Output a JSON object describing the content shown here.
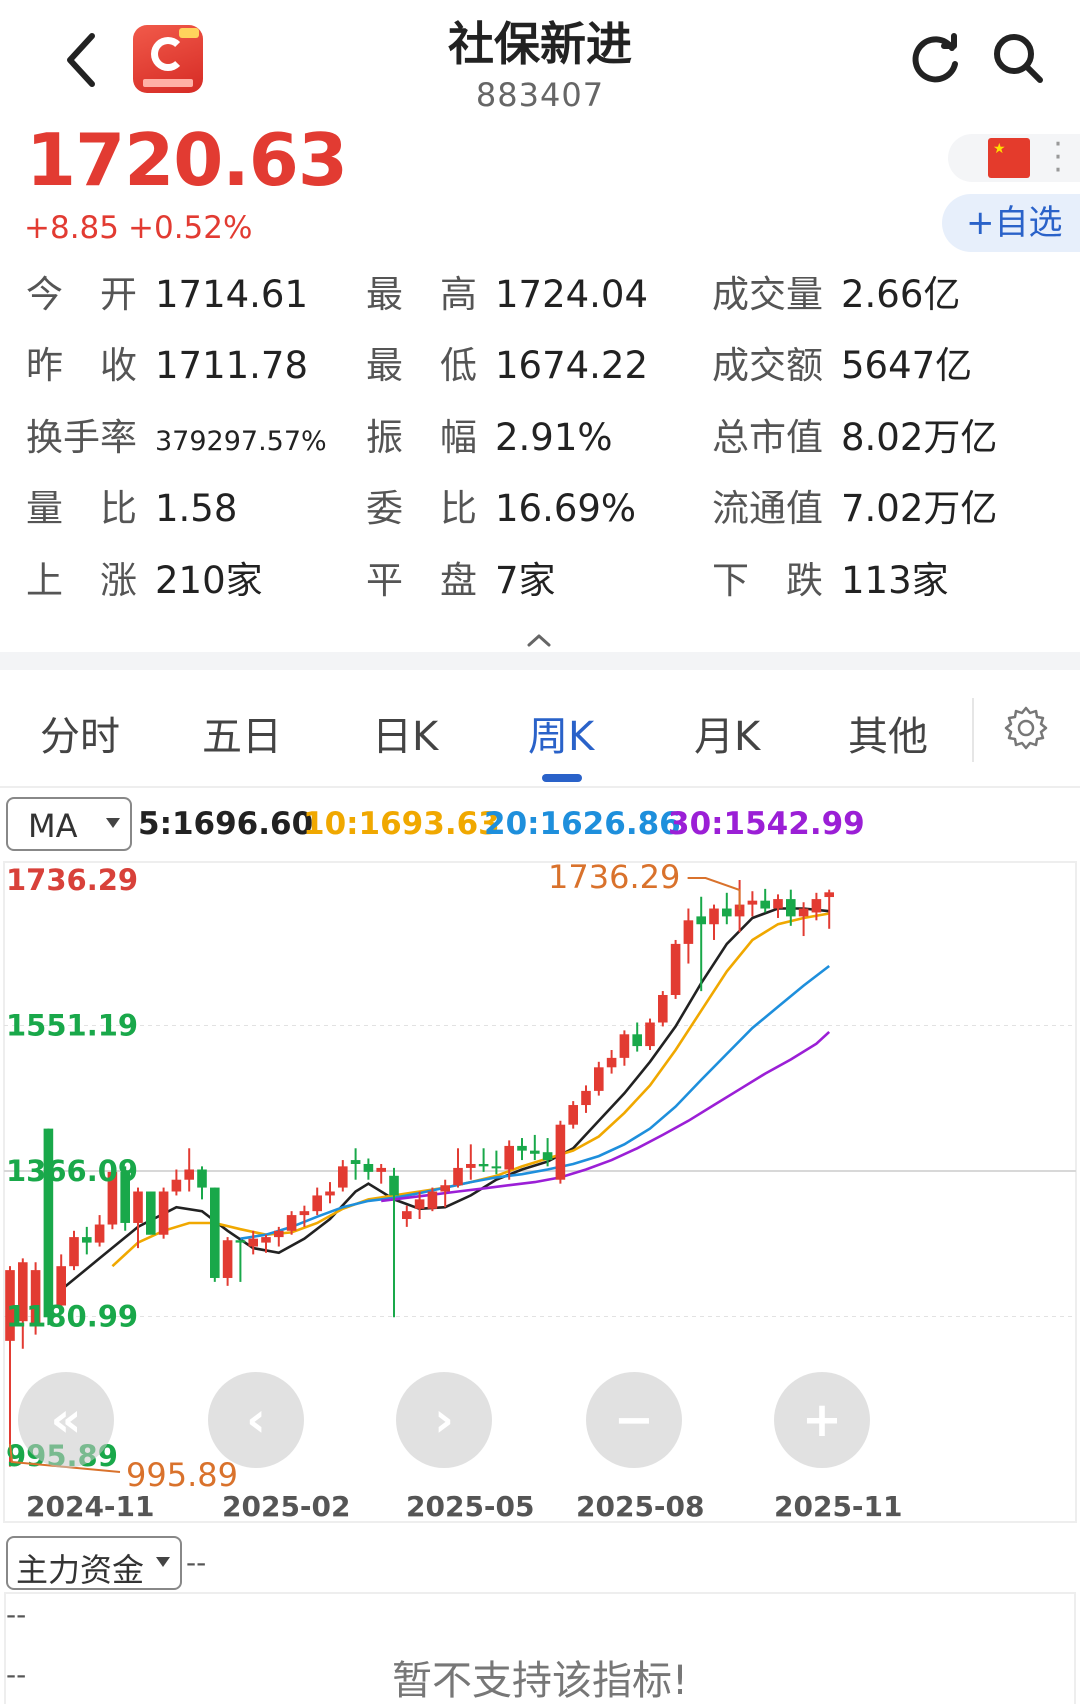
{
  "header": {
    "title": "社保新进",
    "code": "883407"
  },
  "quote": {
    "price": "1720.63",
    "change_abs": "+8.85",
    "change_pct": "+0.52%",
    "fav_label": "+自选"
  },
  "stats": [
    {
      "label": "今　开",
      "value": "1714.61"
    },
    {
      "label": "最　高",
      "value": "1724.04"
    },
    {
      "label": "成交量",
      "value": "2.66亿"
    },
    {
      "label": "昨　收",
      "value": "1711.78"
    },
    {
      "label": "最　低",
      "value": "1674.22"
    },
    {
      "label": "成交额",
      "value": "5647亿"
    },
    {
      "label": "换手率",
      "value": "379297.57%"
    },
    {
      "label": "振　幅",
      "value": "2.91%"
    },
    {
      "label": "总市值",
      "value": "8.02万亿"
    },
    {
      "label": "量　比",
      "value": "1.58"
    },
    {
      "label": "委　比",
      "value": "16.69%"
    },
    {
      "label": "流通值",
      "value": "7.02万亿"
    },
    {
      "label": "上　涨",
      "value": "210家"
    },
    {
      "label": "平　盘",
      "value": "7家"
    },
    {
      "label": "下　跌",
      "value": "113家"
    }
  ],
  "tabs": [
    "分时",
    "五日",
    "日K",
    "周K",
    "月K",
    "其他"
  ],
  "active_tab": "周K",
  "ma": {
    "select_label": "MA",
    "values": [
      {
        "label": "5:1696.60",
        "color": "#222222"
      },
      {
        "label": "10:1693.63",
        "color": "#f0a800"
      },
      {
        "label": "20:1626.86",
        "color": "#1e8fdc"
      },
      {
        "label": "30:1542.99",
        "color": "#9b1fd6"
      }
    ]
  },
  "axis": {
    "y_labels": [
      "1736.29",
      "1551.19",
      "1366.09",
      "1180.99",
      "995.89"
    ],
    "high_marker": "1736.29",
    "low_marker": "995.89",
    "dates": [
      "2024-11",
      "2025-02",
      "2025-05",
      "2025-08",
      "2025-11"
    ]
  },
  "chart_data": {
    "type": "candlestick",
    "period": "weekly",
    "ylim": [
      995.89,
      1736.29
    ],
    "y_ticks": [
      1736.29,
      1551.19,
      1366.09,
      1180.99,
      995.89
    ],
    "x_tick_labels": [
      "2024-11",
      "2025-02",
      "2025-05",
      "2025-08",
      "2025-11"
    ],
    "up_color": "#e23b32",
    "down_color": "#19a84a",
    "candles": [
      {
        "o": 1150,
        "h": 1245,
        "l": 990,
        "c": 1240
      },
      {
        "o": 1175,
        "h": 1255,
        "l": 1140,
        "c": 1250
      },
      {
        "o": 1170,
        "h": 1250,
        "l": 1158,
        "c": 1240
      },
      {
        "o": 1420,
        "h": 1420,
        "l": 1170,
        "c": 1180
      },
      {
        "o": 1195,
        "h": 1260,
        "l": 1185,
        "c": 1245
      },
      {
        "o": 1245,
        "h": 1290,
        "l": 1240,
        "c": 1282
      },
      {
        "o": 1282,
        "h": 1295,
        "l": 1260,
        "c": 1275
      },
      {
        "o": 1275,
        "h": 1310,
        "l": 1270,
        "c": 1298
      },
      {
        "o": 1298,
        "h": 1370,
        "l": 1292,
        "c": 1365
      },
      {
        "o": 1365,
        "h": 1372,
        "l": 1290,
        "c": 1300
      },
      {
        "o": 1300,
        "h": 1345,
        "l": 1268,
        "c": 1340
      },
      {
        "o": 1340,
        "h": 1335,
        "l": 1295,
        "c": 1285
      },
      {
        "o": 1285,
        "h": 1345,
        "l": 1280,
        "c": 1340
      },
      {
        "o": 1340,
        "h": 1368,
        "l": 1335,
        "c": 1355
      },
      {
        "o": 1355,
        "h": 1395,
        "l": 1340,
        "c": 1368
      },
      {
        "o": 1368,
        "h": 1372,
        "l": 1330,
        "c": 1345
      },
      {
        "o": 1345,
        "h": 1345,
        "l": 1225,
        "c": 1230
      },
      {
        "o": 1230,
        "h": 1282,
        "l": 1220,
        "c": 1278
      },
      {
        "o": 1278,
        "h": 1278,
        "l": 1225,
        "c": 1275
      },
      {
        "o": 1270,
        "h": 1290,
        "l": 1260,
        "c": 1280
      },
      {
        "o": 1275,
        "h": 1285,
        "l": 1262,
        "c": 1282
      },
      {
        "o": 1282,
        "h": 1295,
        "l": 1270,
        "c": 1290
      },
      {
        "o": 1290,
        "h": 1315,
        "l": 1285,
        "c": 1310
      },
      {
        "o": 1310,
        "h": 1322,
        "l": 1295,
        "c": 1315
      },
      {
        "o": 1315,
        "h": 1345,
        "l": 1310,
        "c": 1335
      },
      {
        "o": 1335,
        "h": 1352,
        "l": 1325,
        "c": 1340
      },
      {
        "o": 1345,
        "h": 1380,
        "l": 1340,
        "c": 1372
      },
      {
        "o": 1380,
        "h": 1395,
        "l": 1355,
        "c": 1375
      },
      {
        "o": 1375,
        "h": 1382,
        "l": 1355,
        "c": 1365
      },
      {
        "o": 1365,
        "h": 1375,
        "l": 1350,
        "c": 1370
      },
      {
        "o": 1360,
        "h": 1370,
        "l": 1180,
        "c": 1335
      },
      {
        "o": 1305,
        "h": 1322,
        "l": 1295,
        "c": 1315
      },
      {
        "o": 1318,
        "h": 1340,
        "l": 1305,
        "c": 1330
      },
      {
        "o": 1318,
        "h": 1345,
        "l": 1315,
        "c": 1340
      },
      {
        "o": 1340,
        "h": 1355,
        "l": 1320,
        "c": 1348
      },
      {
        "o": 1348,
        "h": 1395,
        "l": 1345,
        "c": 1370
      },
      {
        "o": 1370,
        "h": 1400,
        "l": 1355,
        "c": 1375
      },
      {
        "o": 1375,
        "h": 1395,
        "l": 1365,
        "c": 1372
      },
      {
        "o": 1372,
        "h": 1392,
        "l": 1362,
        "c": 1370
      },
      {
        "o": 1368,
        "h": 1405,
        "l": 1355,
        "c": 1398
      },
      {
        "o": 1398,
        "h": 1408,
        "l": 1380,
        "c": 1392
      },
      {
        "o": 1392,
        "h": 1412,
        "l": 1380,
        "c": 1388
      },
      {
        "o": 1390,
        "h": 1408,
        "l": 1372,
        "c": 1380
      },
      {
        "o": 1355,
        "h": 1430,
        "l": 1350,
        "c": 1425
      },
      {
        "o": 1425,
        "h": 1455,
        "l": 1420,
        "c": 1450
      },
      {
        "o": 1450,
        "h": 1475,
        "l": 1440,
        "c": 1468
      },
      {
        "o": 1468,
        "h": 1505,
        "l": 1462,
        "c": 1498
      },
      {
        "o": 1498,
        "h": 1520,
        "l": 1490,
        "c": 1510
      },
      {
        "o": 1510,
        "h": 1545,
        "l": 1500,
        "c": 1540
      },
      {
        "o": 1540,
        "h": 1555,
        "l": 1518,
        "c": 1525
      },
      {
        "o": 1525,
        "h": 1560,
        "l": 1520,
        "c": 1555
      },
      {
        "o": 1555,
        "h": 1595,
        "l": 1550,
        "c": 1590
      },
      {
        "o": 1590,
        "h": 1660,
        "l": 1585,
        "c": 1655
      },
      {
        "o": 1655,
        "h": 1700,
        "l": 1630,
        "c": 1685
      },
      {
        "o": 1690,
        "h": 1715,
        "l": 1595,
        "c": 1680
      },
      {
        "o": 1680,
        "h": 1705,
        "l": 1660,
        "c": 1700
      },
      {
        "o": 1700,
        "h": 1720,
        "l": 1680,
        "c": 1690
      },
      {
        "o": 1690,
        "h": 1736.29,
        "l": 1670,
        "c": 1705
      },
      {
        "o": 1705,
        "h": 1722,
        "l": 1690,
        "c": 1710
      },
      {
        "o": 1710,
        "h": 1725,
        "l": 1695,
        "c": 1700
      },
      {
        "o": 1700,
        "h": 1718,
        "l": 1688,
        "c": 1712
      },
      {
        "o": 1712,
        "h": 1724,
        "l": 1678,
        "c": 1690
      },
      {
        "o": 1690,
        "h": 1708,
        "l": 1665,
        "c": 1700
      },
      {
        "o": 1695,
        "h": 1720,
        "l": 1685,
        "c": 1712
      },
      {
        "o": 1714.61,
        "h": 1724.04,
        "l": 1674.22,
        "c": 1720.63
      }
    ],
    "ma_series": [
      {
        "name": "5",
        "color": "#222222",
        "values": [
          [
            4,
            1215
          ],
          [
            7,
            1255
          ],
          [
            10,
            1295
          ],
          [
            13,
            1320
          ],
          [
            15,
            1315
          ],
          [
            17,
            1290
          ],
          [
            19,
            1268
          ],
          [
            21,
            1262
          ],
          [
            23,
            1280
          ],
          [
            25,
            1305
          ],
          [
            27,
            1340
          ],
          [
            28,
            1350
          ],
          [
            30,
            1330
          ],
          [
            32,
            1318
          ],
          [
            34,
            1320
          ],
          [
            36,
            1335
          ],
          [
            38,
            1355
          ],
          [
            40,
            1368
          ],
          [
            42,
            1378
          ],
          [
            44,
            1395
          ],
          [
            46,
            1430
          ],
          [
            48,
            1465
          ],
          [
            50,
            1505
          ],
          [
            52,
            1550
          ],
          [
            54,
            1605
          ],
          [
            56,
            1655
          ],
          [
            58,
            1688
          ],
          [
            60,
            1700
          ],
          [
            62,
            1700
          ],
          [
            64,
            1696.6
          ]
        ]
      },
      {
        "name": "10",
        "color": "#f0a800",
        "values": [
          [
            8,
            1245
          ],
          [
            10,
            1275
          ],
          [
            12,
            1290
          ],
          [
            14,
            1300
          ],
          [
            16,
            1300
          ],
          [
            18,
            1292
          ],
          [
            20,
            1285
          ],
          [
            22,
            1288
          ],
          [
            24,
            1300
          ],
          [
            26,
            1318
          ],
          [
            28,
            1330
          ],
          [
            30,
            1335
          ],
          [
            32,
            1340
          ],
          [
            34,
            1345
          ],
          [
            36,
            1352
          ],
          [
            38,
            1360
          ],
          [
            40,
            1372
          ],
          [
            42,
            1382
          ],
          [
            44,
            1392
          ],
          [
            46,
            1410
          ],
          [
            48,
            1440
          ],
          [
            50,
            1475
          ],
          [
            52,
            1520
          ],
          [
            54,
            1570
          ],
          [
            56,
            1620
          ],
          [
            58,
            1660
          ],
          [
            60,
            1680
          ],
          [
            62,
            1688
          ],
          [
            64,
            1693.63
          ]
        ]
      },
      {
        "name": "20",
        "color": "#1e8fdc",
        "values": [
          [
            18,
            1280
          ],
          [
            20,
            1285
          ],
          [
            22,
            1295
          ],
          [
            24,
            1308
          ],
          [
            26,
            1320
          ],
          [
            28,
            1328
          ],
          [
            30,
            1332
          ],
          [
            32,
            1338
          ],
          [
            34,
            1345
          ],
          [
            36,
            1352
          ],
          [
            38,
            1358
          ],
          [
            40,
            1362
          ],
          [
            42,
            1368
          ],
          [
            44,
            1375
          ],
          [
            46,
            1385
          ],
          [
            48,
            1400
          ],
          [
            50,
            1420
          ],
          [
            52,
            1448
          ],
          [
            54,
            1482
          ],
          [
            56,
            1515
          ],
          [
            58,
            1548
          ],
          [
            60,
            1575
          ],
          [
            62,
            1602
          ],
          [
            64,
            1626.86
          ]
        ]
      },
      {
        "name": "30",
        "color": "#9b1fd6",
        "values": [
          [
            29,
            1328
          ],
          [
            31,
            1332
          ],
          [
            33,
            1336
          ],
          [
            35,
            1340
          ],
          [
            37,
            1344
          ],
          [
            39,
            1348
          ],
          [
            41,
            1352
          ],
          [
            43,
            1358
          ],
          [
            45,
            1368
          ],
          [
            47,
            1380
          ],
          [
            49,
            1395
          ],
          [
            51,
            1412
          ],
          [
            53,
            1430
          ],
          [
            55,
            1450
          ],
          [
            57,
            1470
          ],
          [
            59,
            1490
          ],
          [
            61,
            1508
          ],
          [
            63,
            1528
          ],
          [
            64,
            1542.99
          ]
        ]
      }
    ]
  },
  "nav": [
    {
      "id": "fast-back",
      "glyph": "«"
    },
    {
      "id": "back",
      "glyph": "‹"
    },
    {
      "id": "forward",
      "glyph": "›"
    },
    {
      "id": "zoom-out",
      "glyph": "−"
    },
    {
      "id": "zoom-in",
      "glyph": "+"
    }
  ],
  "indicator": {
    "select_label": "主力资金",
    "value": "--",
    "line1": "--",
    "line2": "--",
    "message": "暂不支持该指标!"
  }
}
